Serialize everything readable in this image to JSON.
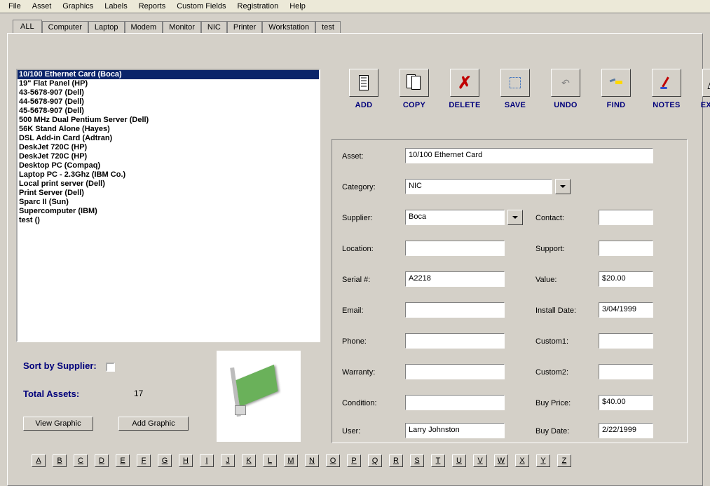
{
  "menu": [
    "File",
    "Asset",
    "Graphics",
    "Labels",
    "Reports",
    "Custom Fields",
    "Registration",
    "Help"
  ],
  "tabs": [
    "ALL",
    "Computer",
    "Laptop",
    "Modem",
    "Monitor",
    "NIC",
    "Printer",
    "Workstation",
    "test"
  ],
  "active_tab": "ALL",
  "assets": [
    "10/100 Ethernet Card (Boca)",
    "19\" Flat Panel (HP)",
    "43-5678-907 (Dell)",
    "44-5678-907 (Dell)",
    "45-5678-907 (Dell)",
    "500 MHz Dual Pentium Server (Dell)",
    "56K Stand Alone (Hayes)",
    "DSL Add-in Card (Adtran)",
    "DeskJet 720C (HP)",
    "DeskJet 720C (HP)",
    "Desktop PC (Compaq)",
    "Laptop PC - 2.3Ghz (IBM Co.)",
    "Local print server (Dell)",
    "Print Server (Dell)",
    "Sparc II (Sun)",
    "Supercomputer (IBM)",
    "test ()"
  ],
  "selected_asset_index": 0,
  "sort_by_supplier_label": "Sort by Supplier:",
  "sort_by_supplier_checked": false,
  "total_assets_label": "Total Assets:",
  "total_assets_value": "17",
  "view_graphic_label": "View Graphic",
  "add_graphic_label": "Add Graphic",
  "toolbar": [
    {
      "key": "add",
      "label": "ADD"
    },
    {
      "key": "copy",
      "label": "COPY"
    },
    {
      "key": "delete",
      "label": "DELETE"
    },
    {
      "key": "save",
      "label": "SAVE"
    },
    {
      "key": "undo",
      "label": "UNDO"
    },
    {
      "key": "find",
      "label": "FIND"
    },
    {
      "key": "notes",
      "label": "NOTES"
    },
    {
      "key": "extras",
      "label": "EXTRAS"
    }
  ],
  "form": {
    "asset": {
      "label": "Asset:",
      "value": "10/100 Ethernet Card"
    },
    "category": {
      "label": "Category:",
      "value": "NIC"
    },
    "supplier": {
      "label": "Supplier:",
      "value": "Boca"
    },
    "contact": {
      "label": "Contact:",
      "value": ""
    },
    "location": {
      "label": "Location:",
      "value": ""
    },
    "support": {
      "label": "Support:",
      "value": ""
    },
    "serial": {
      "label": "Serial #:",
      "value": "A2218"
    },
    "value": {
      "label": "Value:",
      "value": "$20.00"
    },
    "email": {
      "label": "Email:",
      "value": ""
    },
    "install_date": {
      "label": "Install Date:",
      "value": "3/04/1999"
    },
    "phone": {
      "label": "Phone:",
      "value": ""
    },
    "custom1": {
      "label": "Custom1:",
      "value": ""
    },
    "warranty": {
      "label": "Warranty:",
      "value": ""
    },
    "custom2": {
      "label": "Custom2:",
      "value": ""
    },
    "condition": {
      "label": "Condition:",
      "value": ""
    },
    "buy_price": {
      "label": "Buy Price:",
      "value": "$40.00"
    },
    "user": {
      "label": "User:",
      "value": "Larry Johnston"
    },
    "buy_date": {
      "label": "Buy Date:",
      "value": "2/22/1999"
    }
  },
  "alpha": [
    "A",
    "B",
    "C",
    "D",
    "E",
    "F",
    "G",
    "H",
    "I",
    "J",
    "K",
    "L",
    "M",
    "N",
    "O",
    "P",
    "Q",
    "R",
    "S",
    "T",
    "U",
    "V",
    "W",
    "X",
    "Y",
    "Z"
  ]
}
